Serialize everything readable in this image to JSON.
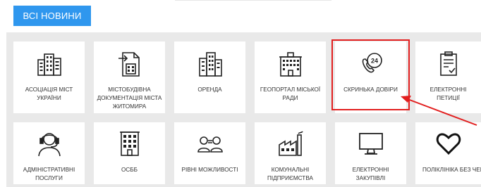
{
  "top": {
    "news_button_label": "ВСІ НОВИНИ"
  },
  "tiles": [
    {
      "label": "АСОЦІАЦІЯ МІСТ УКРАЇНИ",
      "icon": "city-buildings-icon"
    },
    {
      "label": "МІСТОБУДІВНА ДОКУМЕНТАЦІЯ МІСТА ЖИТОМИРА",
      "icon": "building-document-icon"
    },
    {
      "label": "ОРЕНДА",
      "icon": "office-buildings-icon"
    },
    {
      "label": "ГЕОПОРТАЛ МІСЬКОЇ РАДИ",
      "icon": "city-hall-icon"
    },
    {
      "label": "СКРИНЬКА ДОВІРИ",
      "icon": "phone-24-icon"
    },
    {
      "label": "ЕЛЕКТРОННІ ПЕТИЦІЇ",
      "icon": "clipboard-check-icon"
    },
    {
      "label": "АДМІНІСТРАТИВНІ ПОСЛУГИ",
      "icon": "operator-headset-icon"
    },
    {
      "label": "ОСББ",
      "icon": "apartment-building-icon"
    },
    {
      "label": "РІВНІ МОЖЛИВОСТІ",
      "icon": "people-equal-icon"
    },
    {
      "label": "КОМУНАЛЬНІ ПІДПРИЄМСТВА",
      "icon": "factory-icon"
    },
    {
      "label": "ЕЛЕКТРОННІ ЗАКУПІВЛІ",
      "icon": "monitor-icon"
    },
    {
      "label": "ПОЛІКЛІНІКА БЕЗ ЧЕРГ",
      "icon": "heart-icon"
    }
  ],
  "colors": {
    "button": "#2f97ee",
    "highlight": "#e21f1f",
    "panel": "#e9e9e9"
  }
}
